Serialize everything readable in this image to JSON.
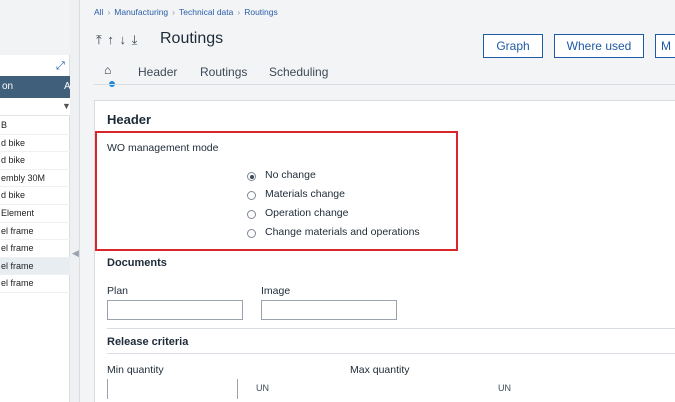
{
  "left_panel": {
    "col1": "on",
    "col2": "A",
    "rows": [
      "B",
      "d bike",
      "d bike",
      "embly 30M",
      "d bike",
      "Element",
      "el frame",
      "el frame",
      "el frame",
      "el frame"
    ]
  },
  "breadcrumb": [
    "All",
    "Manufacturing",
    "Technical data",
    "Routings"
  ],
  "page": {
    "title": "Routings",
    "buttons": {
      "graph": "Graph",
      "where_used": "Where used",
      "more": "M"
    },
    "tabs": {
      "header": "Header",
      "routings": "Routings",
      "scheduling": "Scheduling"
    }
  },
  "header_section": {
    "title": "Header",
    "wo_mode": {
      "label": "WO management mode",
      "options": [
        "No change",
        "Materials change",
        "Operation change",
        "Change materials and operations"
      ],
      "selected": "No change"
    },
    "documents": {
      "title": "Documents",
      "plan_label": "Plan",
      "image_label": "Image"
    },
    "release": {
      "title": "Release criteria",
      "min_label": "Min quantity",
      "max_label": "Max quantity",
      "min_unit": "UN",
      "max_unit": "UN"
    }
  },
  "colors": {
    "accent": "#1f5aa6",
    "highlight_border": "#d9262b",
    "grid_header": "#3f5f7a"
  }
}
